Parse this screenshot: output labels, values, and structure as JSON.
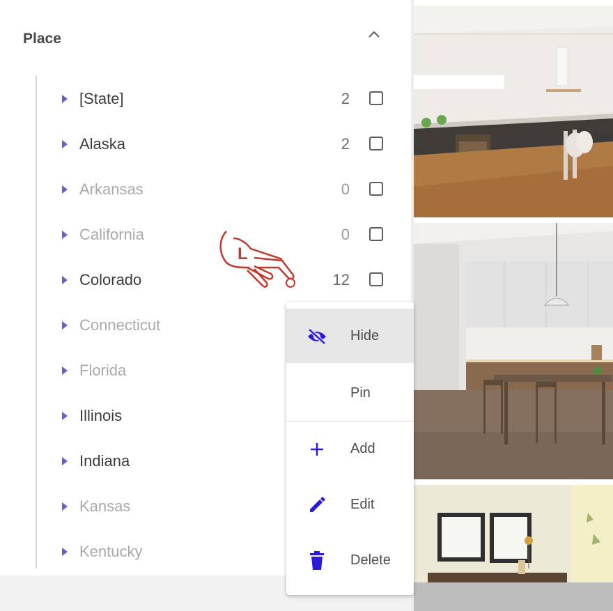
{
  "filter_panel": {
    "title": "Place",
    "collapse_icon": "chevron-up-icon",
    "items": [
      {
        "label": "[State]",
        "count": "2",
        "enabled": true
      },
      {
        "label": "Alaska",
        "count": "2",
        "enabled": true
      },
      {
        "label": "Arkansas",
        "count": "0",
        "enabled": false
      },
      {
        "label": "California",
        "count": "0",
        "enabled": false
      },
      {
        "label": "Colorado",
        "count": "12",
        "enabled": true
      },
      {
        "label": "Connecticut",
        "count": "",
        "enabled": false
      },
      {
        "label": "Florida",
        "count": "",
        "enabled": false
      },
      {
        "label": "Illinois",
        "count": "",
        "enabled": true
      },
      {
        "label": "Indiana",
        "count": "",
        "enabled": true
      },
      {
        "label": "Kansas",
        "count": "",
        "enabled": false
      },
      {
        "label": "Kentucky",
        "count": "",
        "enabled": false
      }
    ]
  },
  "context_menu": {
    "items": [
      {
        "label": "Hide",
        "icon": "eye-off-icon",
        "active": true
      },
      {
        "label": "Pin",
        "icon": "",
        "active": false
      },
      {
        "label": "Add",
        "icon": "plus-icon",
        "active": false
      },
      {
        "label": "Edit",
        "icon": "pencil-icon",
        "active": false
      },
      {
        "label": "Delete",
        "icon": "trash-icon",
        "active": false
      }
    ]
  },
  "pointer": {
    "label": "L",
    "icon": "hand-pointer-icon"
  },
  "colors": {
    "accent": "#2b1bd8",
    "caret": "#6b5bd6",
    "pointer": "#c0392b",
    "menu_active_bg": "#e6e6e6"
  },
  "photos": [
    {
      "subject": "kitchen-interior"
    },
    {
      "subject": "dining-room-interior"
    },
    {
      "subject": "living-room-wall-frames"
    }
  ]
}
